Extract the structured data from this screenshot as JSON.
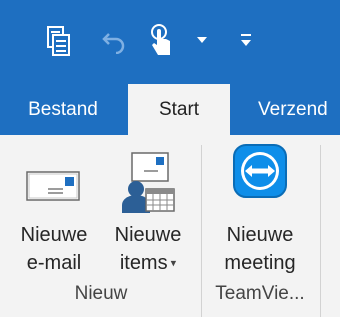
{
  "quick_access": {
    "items": [
      {
        "icon": "send-receive-icon"
      },
      {
        "icon": "undo-icon"
      },
      {
        "icon": "touch-mode-icon"
      },
      {
        "icon": "dropdown-arrow-icon"
      },
      {
        "icon": "customize-toolbar-icon"
      }
    ]
  },
  "tabs": {
    "bestand": "Bestand",
    "start": "Start",
    "verzend": "Verzend"
  },
  "ribbon": {
    "new_email": {
      "line1": "Nieuwe",
      "line2": "e-mail"
    },
    "new_items": {
      "line1": "Nieuwe",
      "line2": "items"
    },
    "new_meeting": {
      "line1": "Nieuwe",
      "line2": "meeting"
    },
    "groups": {
      "nieuw": "Nieuw",
      "teamviewer": "TeamVie..."
    }
  },
  "colors": {
    "title_bar": "#1e6fc1",
    "ribbon_bg": "#f3f3f3",
    "teamviewer_blue": "#0e8ee9"
  }
}
